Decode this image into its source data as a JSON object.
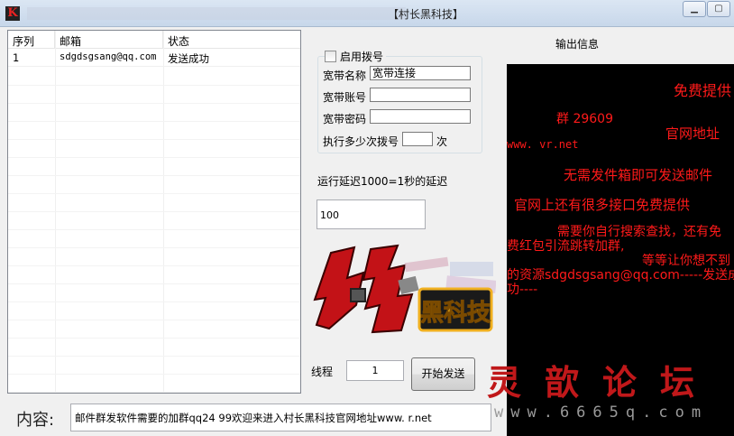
{
  "window": {
    "title_visible": "黑科技】",
    "title_partial": "【村长黑科技】"
  },
  "list": {
    "columns": [
      "序列",
      "邮箱",
      "状态"
    ],
    "rows": [
      {
        "index": "1",
        "email": "sdgdsgsang@qq.com",
        "status": "发送成功"
      }
    ]
  },
  "dial": {
    "enable_label": "启用拨号",
    "broadband_name_label": "宽带名称",
    "broadband_name_value": "宽带连接",
    "broadband_account_label": "宽带账号",
    "broadband_account_value": "",
    "broadband_password_label": "宽带密码",
    "broadband_password_value": "",
    "dial_count_label": "执行多少次拨号",
    "dial_count_value": "",
    "dial_count_unit": "次"
  },
  "delay": {
    "label": "运行延迟1000=1秒的延迟",
    "value": "100"
  },
  "logo": {
    "text": "黑科技"
  },
  "thread": {
    "label": "线程",
    "value": "1"
  },
  "start_button": "开始发送",
  "output": {
    "title": "输出信息",
    "lines": [
      "免费提供",
      "群 29609",
      "官网地址",
      "www.    vr.net",
      "无需发件箱即可发送邮件",
      "官网上还有很多接口免费提供",
      "需要你自行搜索查找，还有免",
      "费红包引流跳转加群,",
      "等等让你想不到",
      "的资源sdgdsgsang@qq.com-----发送成",
      "功----"
    ]
  },
  "content": {
    "label": "内容:",
    "value": "邮件群发软件需要的加群qq24      99欢迎来进入村长黑科技官网地址www.       r.net"
  },
  "watermark": {
    "chinese": "灵歆论坛",
    "url": "www.6665q.com"
  },
  "colors": {
    "output_bg": "#000000",
    "output_text": "#ff1a1a",
    "watermark": "#c0181a"
  }
}
